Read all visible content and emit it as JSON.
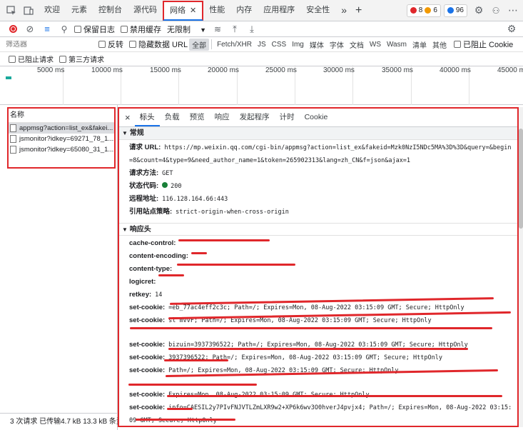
{
  "tabbar": {
    "tabs": [
      "欢迎",
      "元素",
      "控制台",
      "源代码",
      "网络",
      "性能",
      "内存",
      "应用程序",
      "安全性"
    ],
    "active_index": 4,
    "more": "»",
    "add": "+",
    "errors": "8",
    "warnings": "6",
    "messages": "96"
  },
  "toolbar": {
    "preserve_log": "保留日志",
    "disable_cache": "禁用缓存",
    "throttle": "无限制"
  },
  "filter": {
    "placeholder": "筛选器",
    "invert": "反转",
    "hide_data_urls": "隐藏数据 URL",
    "types": [
      "全部",
      "Fetch/XHR",
      "JS",
      "CSS",
      "Img",
      "媒体",
      "字体",
      "文档",
      "WS",
      "Wasm",
      "清单",
      "其他"
    ],
    "blocked_cookies": "已阻止 Cookie",
    "blocked_requests": "已阻止请求",
    "third_party": "第三方请求"
  },
  "timeline": {
    "ticks": [
      "5000 ms",
      "10000 ms",
      "15000 ms",
      "20000 ms",
      "25000 ms",
      "30000 ms",
      "35000 ms",
      "40000 ms",
      "45000 m"
    ]
  },
  "request_list": {
    "header": "名称",
    "items": [
      "appmsg?action=list_ex&fakei...",
      "jsmonitor?idkey=69271_78_1...",
      "jsmonitor?idkey=65080_31_1..."
    ],
    "status": "3 次请求  已传输4.7 kB  13.3 kB 条资"
  },
  "detail": {
    "close": "×",
    "tabs": [
      "标头",
      "负载",
      "预览",
      "响应",
      "发起程序",
      "计时",
      "Cookie"
    ],
    "general_title": "常规",
    "general": {
      "url_label": "请求 URL:",
      "url": "https://mp.weixin.qq.com/cgi-bin/appmsg?action=list_ex&fakeid=Mzk0NzI5NDc5MA%3D%3D&query=&begin=8&count=4&type=9&need_author_name=1&token=265902313&lang=zh_CN&f=json&ajax=1",
      "method_label": "请求方法:",
      "method": "GET",
      "status_label": "状态代码:",
      "status": "200",
      "remote_label": "远程地址:",
      "remote": "116.128.164.66:443",
      "referrer_label": "引用站点策略:",
      "referrer": "strict-origin-when-cross-origin"
    },
    "response_title": "响应头",
    "response_headers": [
      {
        "k": "cache-control:",
        "v": ""
      },
      {
        "k": "content-encoding:",
        "v": ""
      },
      {
        "k": "content-type:",
        "v": ""
      },
      {
        "k": "logicret:",
        "v": ""
      },
      {
        "k": "retkey:",
        "v": "14"
      },
      {
        "k": "set-cookie:",
        "v": "=eb_77ac4eff2c3c; Path=/; Expires=Mon, 08-Aug-2022 03:15:09 GMT; Secure; HttpOnly"
      },
      {
        "k": "set-cookie:",
        "v": "sl              mvvF; Path=/; Expires=Mon, 08-Aug-2022 03:15:09 GMT; Secure; HttpOnly"
      },
      {
        "k": "set-cookie:",
        "v": "bizuin=3937396522; Path=/; Expires=Mon, 08-Aug-2022 03:15:09 GMT; Secure; HttpOnly"
      },
      {
        "k": "set-cookie:",
        "v": "3937396522; Path=/; Expires=Mon, 08-Aug-2022 03:15:09 GMT; Secure; HttpOnly"
      },
      {
        "k": "set-cookie:",
        "v": "Path=/; Expires=Mon, 08-Aug-2022 03:15:09 GMT; Secure; HttpOnly"
      },
      {
        "k": "set-cookie:",
        "v": "Expires=Mon, 08-Aug-2022 03:15:09 GMT; Secure; HttpOnly"
      },
      {
        "k": "set-cookie:",
        "v": "info=CAESIL2y7PIvFNJVTLZmLXR9w2+XP6k6wv3O0hverJ4pvjx4; Path=/; Expires=Mon, 08-Aug-2022 03:15:09 GMT; Secure; HttpOnly"
      }
    ]
  },
  "colors": {
    "accent": "#1a73e8",
    "annotation": "#e0272b",
    "error": "#e0272b",
    "warning": "#f29900",
    "info": "#1a73e8"
  }
}
